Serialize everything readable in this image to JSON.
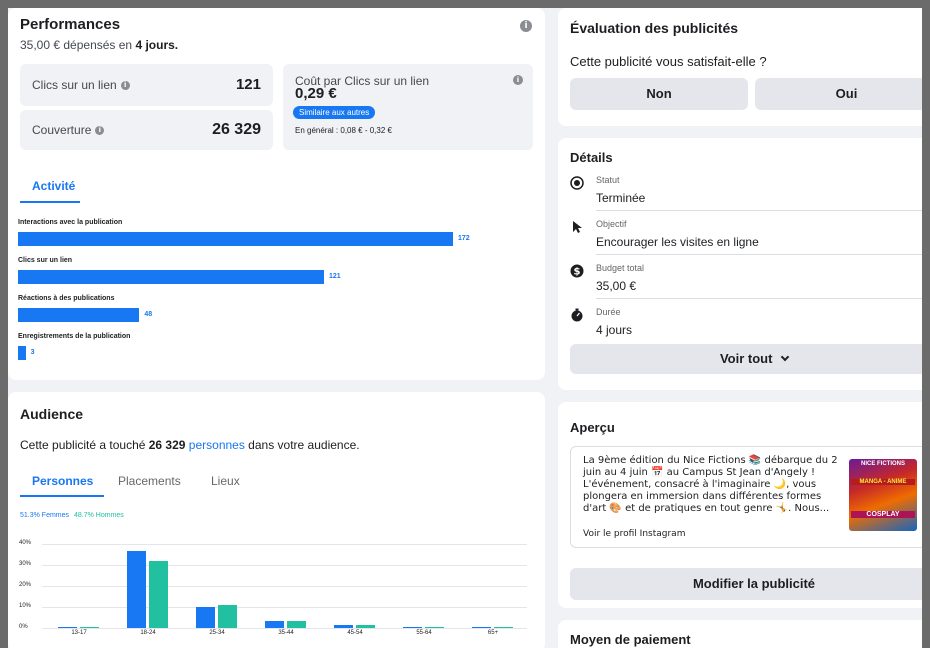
{
  "performance": {
    "title": "Performances",
    "spent_prefix": "35,00 € ",
    "spent_mid": "dépensés en ",
    "spent_days": "4 jours.",
    "link_clicks_label": "Clics sur un lien",
    "link_clicks_value": "121",
    "reach_label": "Couverture",
    "reach_value": "26 329",
    "cost_label": "Coût par Clics sur un lien",
    "cost_value": "0,29 €",
    "cost_badge": "Similaire aux autres",
    "cost_range": "En général : 0,08 € - 0,32 €",
    "info_glyph": "i"
  },
  "activity": {
    "tab": "Activité",
    "bars": [
      {
        "label": "Interactions avec la publication",
        "value": 172
      },
      {
        "label": "Clics sur un lien",
        "value": 121
      },
      {
        "label": "Réactions à des publications",
        "value": 48
      },
      {
        "label": "Enregistrements de la publication",
        "value": 3
      }
    ]
  },
  "audience": {
    "title": "Audience",
    "sentence_prefix": "Cette publicité a touché ",
    "sentence_count": "26 329",
    "sentence_link": "personnes",
    "sentence_suffix": " dans votre audience.",
    "tabs": [
      "Personnes",
      "Placements",
      "Lieux"
    ],
    "legend_women": "51.3% Femmes",
    "legend_men": "48.7% Hommes"
  },
  "chart_data": {
    "type": "bar",
    "categories": [
      "13-17",
      "18-24",
      "25-34",
      "35-44",
      "45-54",
      "55-64",
      "65+"
    ],
    "series": [
      {
        "name": "Femmes",
        "color": "#1877f2",
        "values": [
          0.3,
          36.5,
          9.8,
          3.5,
          1.2,
          0.5,
          0.3
        ]
      },
      {
        "name": "Hommes",
        "color": "#20c0a0",
        "values": [
          0.3,
          32.0,
          11.0,
          3.5,
          1.3,
          0.6,
          0.4
        ]
      }
    ],
    "yticks": [
      "40%",
      "30%",
      "20%",
      "10%",
      "0%"
    ],
    "ylim": [
      0,
      40
    ],
    "grid": true,
    "legend": "top-left"
  },
  "evaluation": {
    "title": "Évaluation des publicités",
    "question": "Cette publicité vous satisfait-elle ?",
    "no": "Non",
    "yes": "Oui"
  },
  "details": {
    "title": "Détails",
    "items": [
      {
        "icon": "status-icon",
        "label": "Statut",
        "value": "Terminée"
      },
      {
        "icon": "cursor-icon",
        "label": "Objectif",
        "value": "Encourager les visites en ligne"
      },
      {
        "icon": "dollar-icon",
        "label": "Budget total",
        "value": "35,00 €"
      },
      {
        "icon": "stopwatch-icon",
        "label": "Durée",
        "value": "4 jours"
      }
    ],
    "see_all": "Voir tout"
  },
  "preview": {
    "title": "Aperçu",
    "text": "La 9ème édition du Nice Fictions 📚 débarque du 2 juin au 4 juin 📅 au Campus St Jean d'Angely ! L'événement, consacré à l'imaginaire 🌙, vous plongera en immersion dans différentes formes d'art 🎨 et de pratiques en tout genre 🤸. Nous...",
    "link": "Voir le profil Instagram",
    "edit_button": "Modifier la publicité",
    "thumb_texts": [
      "NICE FICTIONS",
      "MANGA - ANIME",
      "COSPLAY"
    ]
  },
  "payment": {
    "title": "Moyen de paiement"
  },
  "colors": {
    "accent": "#1877f2",
    "teal": "#20c0a0",
    "bg": "#f0f2f5"
  }
}
